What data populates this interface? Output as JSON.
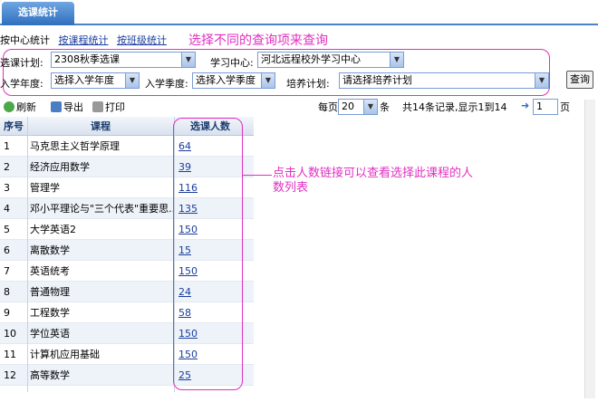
{
  "tab": {
    "label": "选课统计"
  },
  "links": {
    "by_center": "按中心统计",
    "by_course": "按课程统计",
    "by_class": "按班级统计"
  },
  "annotations": {
    "filter_note": "选择不同的查询项来查询",
    "count_note": "点击人数链接可以查看选择此课程的人数列表"
  },
  "filters": {
    "plan_label": "选课计划:",
    "plan_value": "2308秋季选课",
    "center_label": "学习中心:",
    "center_value": "河北远程校外学习中心",
    "year_label": "入学年度:",
    "year_value": "选择入学年度",
    "season_label": "入学季度:",
    "season_value": "选择入学季度",
    "training_label": "培养计划:",
    "training_value": "请选择培养计划",
    "query_button": "查询"
  },
  "toolbar": {
    "refresh": "刷新",
    "export": "导出",
    "print": "打印",
    "per_page_label": "每页",
    "per_page_value": "20",
    "per_page_unit": "条",
    "summary": "共14条记录,显示1到14",
    "page_value": "1",
    "page_unit": "页"
  },
  "table": {
    "headers": {
      "no": "序号",
      "course": "课程",
      "count": "选课人数"
    },
    "rows": [
      {
        "no": "1",
        "course": "马克思主义哲学原理",
        "count": "64"
      },
      {
        "no": "2",
        "course": "经济应用数学",
        "count": "39"
      },
      {
        "no": "3",
        "course": "管理学",
        "count": "116"
      },
      {
        "no": "4",
        "course": "邓小平理论与\"三个代表\"重要思...",
        "count": "135"
      },
      {
        "no": "5",
        "course": "大学英语2",
        "count": "150"
      },
      {
        "no": "6",
        "course": "离散数学",
        "count": "15"
      },
      {
        "no": "7",
        "course": "英语统考",
        "count": "150"
      },
      {
        "no": "8",
        "course": "普通物理",
        "count": "24"
      },
      {
        "no": "9",
        "course": "工程数学",
        "count": "58"
      },
      {
        "no": "10",
        "course": "学位英语",
        "count": "150"
      },
      {
        "no": "11",
        "course": "计算机应用基础",
        "count": "150"
      },
      {
        "no": "12",
        "course": "高等数学",
        "count": "25"
      }
    ]
  },
  "colors": {
    "accent": "#e030c0",
    "link": "#1a3d9c",
    "tab": "#2f6fbf"
  }
}
